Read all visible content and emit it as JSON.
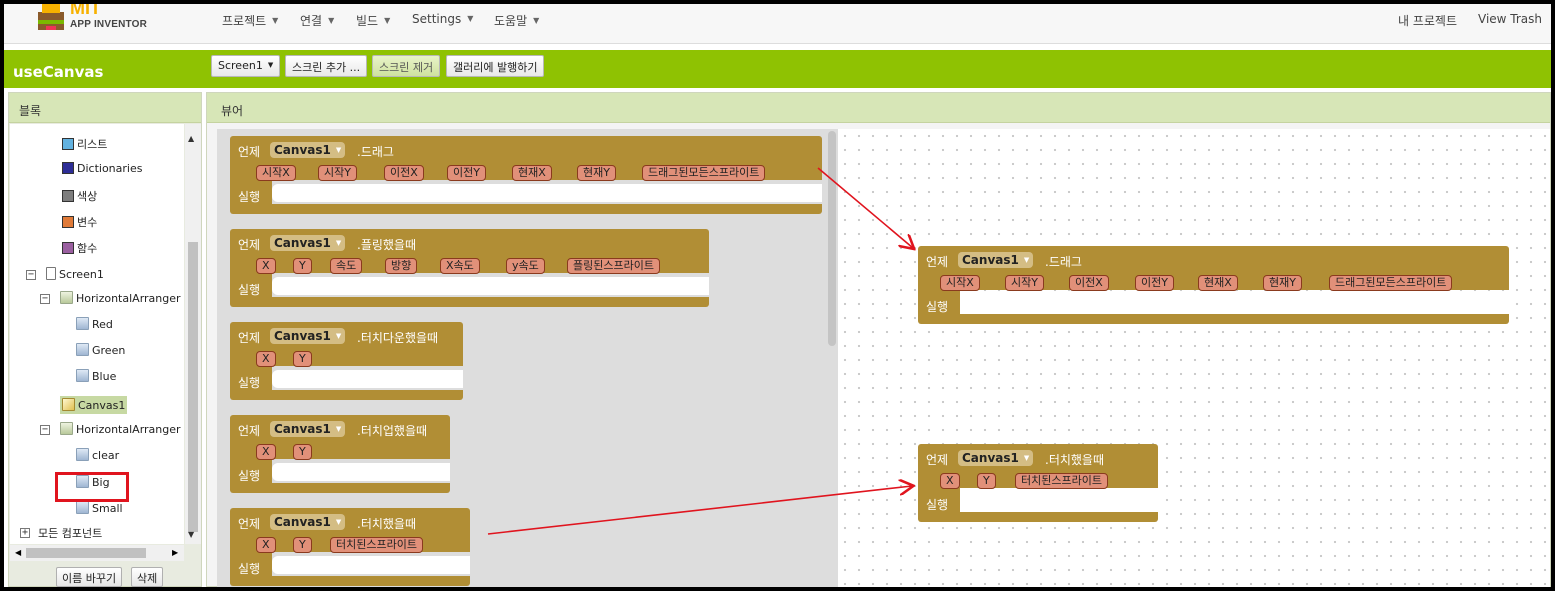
{
  "topbar": {
    "logo_mit": "MIT",
    "logo_sub": "APP INVENTOR",
    "menus": [
      "프로젝트",
      "연결",
      "빌드",
      "Settings",
      "도움말"
    ],
    "right_links": [
      "내 프로젝트",
      "View Trash"
    ]
  },
  "toolbar": {
    "app_name": "useCanvas",
    "screen_select": "Screen1",
    "add_screen": "스크린 추가 ...",
    "remove_screen": "스크린 제거",
    "publish_gallery": "갤러리에 발행하기"
  },
  "blocks_panel": {
    "title": "블록",
    "builtin": [
      {
        "label": "리스트",
        "color": "#62b2e0"
      },
      {
        "label": "Dictionaries",
        "color": "#2d2d96"
      },
      {
        "label": "색상",
        "color": "#7d7d7d"
      },
      {
        "label": "변수",
        "color": "#e07a38"
      },
      {
        "label": "함수",
        "color": "#9a5fa0"
      }
    ],
    "components": {
      "screen": "Screen1",
      "arranger1": "HorizontalArranger",
      "red": "Red",
      "green": "Green",
      "blue": "Blue",
      "canvas": "Canvas1",
      "arranger2": "HorizontalArranger",
      "clear": "clear",
      "big": "Big",
      "small": "Small"
    },
    "any_component": "모든 컴포넌트",
    "rename_button": "이름 바꾸기",
    "delete_button": "삭제"
  },
  "viewer": {
    "title": "뷰어",
    "when": "언제",
    "do": "실행",
    "component": "Canvas1",
    "flyout": [
      {
        "event": ".드래그",
        "params": [
          "시작X",
          "시작Y",
          "이전X",
          "이전Y",
          "현재X",
          "현재Y",
          "드래그된모든스프라이트"
        ]
      },
      {
        "event": ".플링했을때",
        "params": [
          "X",
          "Y",
          "속도",
          "방향",
          "X속도",
          "y속도",
          "플링된스프라이트"
        ]
      },
      {
        "event": ".터치다운했을때",
        "params": [
          "X",
          "Y"
        ]
      },
      {
        "event": ".터치업했을때",
        "params": [
          "X",
          "Y"
        ]
      },
      {
        "event": ".터치했을때",
        "params": [
          "X",
          "Y",
          "터치된스프라이트"
        ]
      }
    ],
    "workspace": [
      {
        "event": ".드래그",
        "params": [
          "시작X",
          "시작Y",
          "이전X",
          "이전Y",
          "현재X",
          "현재Y",
          "드래그된모든스프라이트"
        ]
      },
      {
        "event": ".터치했을때",
        "params": [
          "X",
          "Y",
          "터치된스프라이트"
        ]
      }
    ]
  },
  "colors": {
    "green_bar": "#8fc202",
    "event_block": "#b18e35",
    "param": "#e19079",
    "highlight": "#e0141e"
  }
}
